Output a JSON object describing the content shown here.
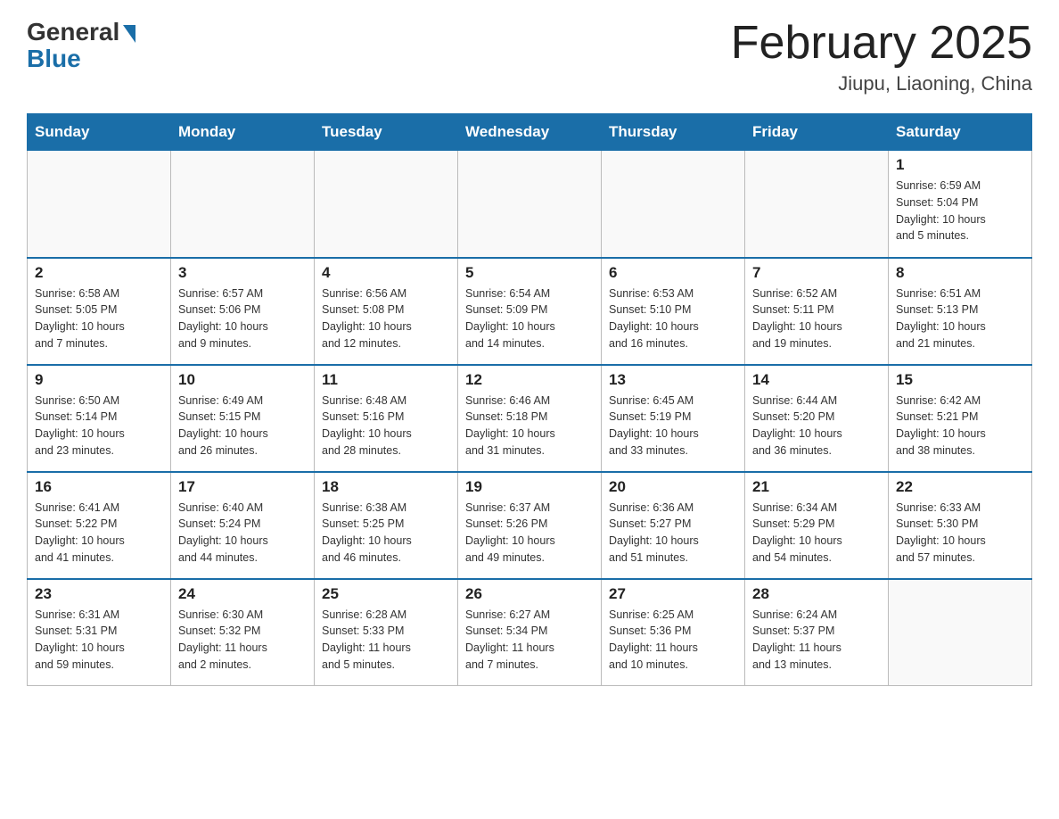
{
  "header": {
    "logo_general": "General",
    "logo_blue": "Blue",
    "month_title": "February 2025",
    "location": "Jiupu, Liaoning, China"
  },
  "weekdays": [
    "Sunday",
    "Monday",
    "Tuesday",
    "Wednesday",
    "Thursday",
    "Friday",
    "Saturday"
  ],
  "weeks": [
    [
      {
        "day": "",
        "info": ""
      },
      {
        "day": "",
        "info": ""
      },
      {
        "day": "",
        "info": ""
      },
      {
        "day": "",
        "info": ""
      },
      {
        "day": "",
        "info": ""
      },
      {
        "day": "",
        "info": ""
      },
      {
        "day": "1",
        "info": "Sunrise: 6:59 AM\nSunset: 5:04 PM\nDaylight: 10 hours\nand 5 minutes."
      }
    ],
    [
      {
        "day": "2",
        "info": "Sunrise: 6:58 AM\nSunset: 5:05 PM\nDaylight: 10 hours\nand 7 minutes."
      },
      {
        "day": "3",
        "info": "Sunrise: 6:57 AM\nSunset: 5:06 PM\nDaylight: 10 hours\nand 9 minutes."
      },
      {
        "day": "4",
        "info": "Sunrise: 6:56 AM\nSunset: 5:08 PM\nDaylight: 10 hours\nand 12 minutes."
      },
      {
        "day": "5",
        "info": "Sunrise: 6:54 AM\nSunset: 5:09 PM\nDaylight: 10 hours\nand 14 minutes."
      },
      {
        "day": "6",
        "info": "Sunrise: 6:53 AM\nSunset: 5:10 PM\nDaylight: 10 hours\nand 16 minutes."
      },
      {
        "day": "7",
        "info": "Sunrise: 6:52 AM\nSunset: 5:11 PM\nDaylight: 10 hours\nand 19 minutes."
      },
      {
        "day": "8",
        "info": "Sunrise: 6:51 AM\nSunset: 5:13 PM\nDaylight: 10 hours\nand 21 minutes."
      }
    ],
    [
      {
        "day": "9",
        "info": "Sunrise: 6:50 AM\nSunset: 5:14 PM\nDaylight: 10 hours\nand 23 minutes."
      },
      {
        "day": "10",
        "info": "Sunrise: 6:49 AM\nSunset: 5:15 PM\nDaylight: 10 hours\nand 26 minutes."
      },
      {
        "day": "11",
        "info": "Sunrise: 6:48 AM\nSunset: 5:16 PM\nDaylight: 10 hours\nand 28 minutes."
      },
      {
        "day": "12",
        "info": "Sunrise: 6:46 AM\nSunset: 5:18 PM\nDaylight: 10 hours\nand 31 minutes."
      },
      {
        "day": "13",
        "info": "Sunrise: 6:45 AM\nSunset: 5:19 PM\nDaylight: 10 hours\nand 33 minutes."
      },
      {
        "day": "14",
        "info": "Sunrise: 6:44 AM\nSunset: 5:20 PM\nDaylight: 10 hours\nand 36 minutes."
      },
      {
        "day": "15",
        "info": "Sunrise: 6:42 AM\nSunset: 5:21 PM\nDaylight: 10 hours\nand 38 minutes."
      }
    ],
    [
      {
        "day": "16",
        "info": "Sunrise: 6:41 AM\nSunset: 5:22 PM\nDaylight: 10 hours\nand 41 minutes."
      },
      {
        "day": "17",
        "info": "Sunrise: 6:40 AM\nSunset: 5:24 PM\nDaylight: 10 hours\nand 44 minutes."
      },
      {
        "day": "18",
        "info": "Sunrise: 6:38 AM\nSunset: 5:25 PM\nDaylight: 10 hours\nand 46 minutes."
      },
      {
        "day": "19",
        "info": "Sunrise: 6:37 AM\nSunset: 5:26 PM\nDaylight: 10 hours\nand 49 minutes."
      },
      {
        "day": "20",
        "info": "Sunrise: 6:36 AM\nSunset: 5:27 PM\nDaylight: 10 hours\nand 51 minutes."
      },
      {
        "day": "21",
        "info": "Sunrise: 6:34 AM\nSunset: 5:29 PM\nDaylight: 10 hours\nand 54 minutes."
      },
      {
        "day": "22",
        "info": "Sunrise: 6:33 AM\nSunset: 5:30 PM\nDaylight: 10 hours\nand 57 minutes."
      }
    ],
    [
      {
        "day": "23",
        "info": "Sunrise: 6:31 AM\nSunset: 5:31 PM\nDaylight: 10 hours\nand 59 minutes."
      },
      {
        "day": "24",
        "info": "Sunrise: 6:30 AM\nSunset: 5:32 PM\nDaylight: 11 hours\nand 2 minutes."
      },
      {
        "day": "25",
        "info": "Sunrise: 6:28 AM\nSunset: 5:33 PM\nDaylight: 11 hours\nand 5 minutes."
      },
      {
        "day": "26",
        "info": "Sunrise: 6:27 AM\nSunset: 5:34 PM\nDaylight: 11 hours\nand 7 minutes."
      },
      {
        "day": "27",
        "info": "Sunrise: 6:25 AM\nSunset: 5:36 PM\nDaylight: 11 hours\nand 10 minutes."
      },
      {
        "day": "28",
        "info": "Sunrise: 6:24 AM\nSunset: 5:37 PM\nDaylight: 11 hours\nand 13 minutes."
      },
      {
        "day": "",
        "info": ""
      }
    ]
  ]
}
